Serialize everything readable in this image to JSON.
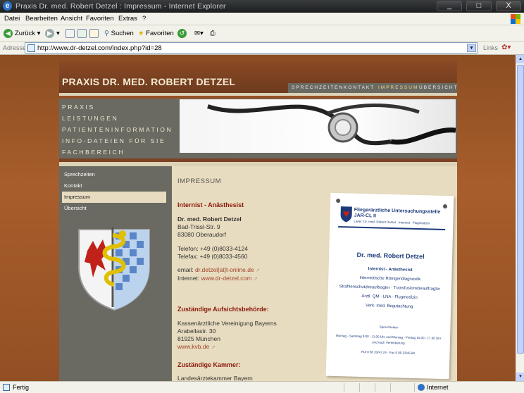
{
  "window": {
    "title": "Praxis Dr. med. Robert Detzel : Impressum - Internet Explorer",
    "min": "_",
    "max": "□",
    "close": "X"
  },
  "menu": [
    "Datei",
    "Bearbeiten",
    "Ansicht",
    "Favoriten",
    "Extras",
    "?"
  ],
  "toolbar": {
    "back": "Zurück",
    "search": "Suchen",
    "favorites": "Favoriten"
  },
  "address": {
    "label": "Adresse",
    "url": "http://www.dr-detzel.com/index.php?id=28",
    "links": "Links"
  },
  "site": {
    "brand": "PRAXIS DR. MED. ROBERT DETZEL",
    "topnav": [
      "SPRECHZEITEN",
      "KONTAKT",
      "IMPRESSUM",
      "ÜBERSICHT"
    ],
    "mainnav": [
      "PRAXIS",
      "LEISTUNGEN",
      "PATIENTENINFORMATION",
      "INFO-DATEIEN FÜR SIE",
      "FACHBEREICH"
    ],
    "subnav": [
      "Sprechzeiten",
      "Kontakt",
      "Impressum",
      "Übersicht"
    ],
    "heading": "IMPRESSUM",
    "profession": "Internist - Anästhesist",
    "address": {
      "name": "Dr. med. Robert Detzel",
      "street": "Bad-Trissl-Str. 9",
      "city": "83080 Oberaudorf"
    },
    "phone": "Telefon: +49 (0)8033-4124",
    "fax": "Telefax: +49 (0)8033-4560",
    "email_label": "email: ",
    "email": "dr.detzel[at]t-online.de",
    "internet_label": "Internet: ",
    "internet": "www.dr-detzel.com",
    "authority_heading": "Zuständige Aufsichtsbehörde:",
    "authority": {
      "name": "Kassenärztliche Vereinigung Bayerns",
      "street": "Arabellastr. 30",
      "city": "81925 München",
      "link": "www.kvb.de"
    },
    "chamber_heading": "Zuständige Kammer:",
    "chamber_name": "Landesärztekammer Bayern"
  },
  "sign": {
    "title": "Fliegerärztliche Untersuchungsstelle JAR-CL II",
    "subtitle": "Leiter: Dr. med. Robert Detzel · Internist · Flugmedizin",
    "name": "Dr. med. Robert Detzel",
    "lines": [
      "Internist - Anästhesist",
      "Internistische Röntgendiagnostik",
      "Strahlenschutzbeauftragter · Transfusionsbeauftragter",
      "Ärztl. QM · LNA · Flugmedizin",
      "Verk. med. Begutachtung"
    ],
    "hours_title": "Sprechzeiten",
    "hours": "Montag - Samstag 9.00 - 11.00 Uhr und Montag - Freitag 15.00 - 17.00 Uhr",
    "hours2": "und nach Vereinbarung",
    "phone": "Ruf 0 80 33/41 24 · Fax 0 80 33/45 60"
  },
  "status": {
    "text": "Fertig",
    "zone": "Internet"
  }
}
